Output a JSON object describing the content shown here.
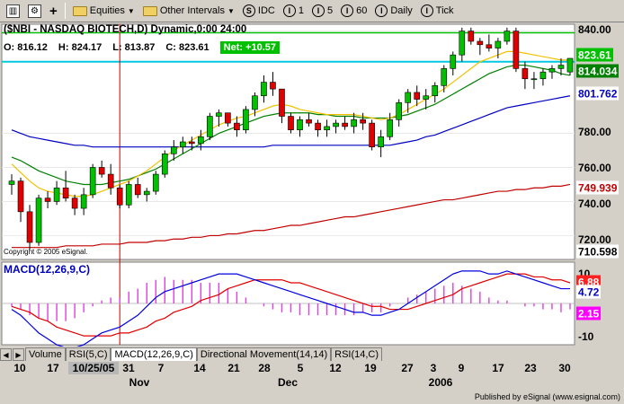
{
  "toolbar": {
    "equities_label": "Equities",
    "intervals_label": "Other Intervals",
    "intervals": [
      {
        "icon": "S",
        "label": "IDC"
      },
      {
        "icon": "I",
        "label": "1"
      },
      {
        "icon": "I",
        "label": "5"
      },
      {
        "icon": "I",
        "label": "60"
      },
      {
        "icon": "I",
        "label": "Daily"
      },
      {
        "icon": "I",
        "label": "Tick"
      }
    ]
  },
  "chart": {
    "title": "($NBI - NASDAQ BIOTECH,D) Dynamic,0:00 24:00",
    "open": "O: 816.12",
    "high": "H: 824.17",
    "low": "L: 813.87",
    "close": "C: 823.61",
    "net": "Net: +10.57",
    "copyright": "Copyright © 2005 eSignal.",
    "price_badges": [
      {
        "label": "823.61",
        "bg": "#00c000",
        "fg": "#ffffff"
      },
      {
        "label": "814.034",
        "bg": "#008000",
        "fg": "#ffffff"
      },
      {
        "label": "801.762",
        "bg": "#ffffff",
        "fg": "#0000c0"
      },
      {
        "label": "749.939",
        "bg": "#ffffff",
        "fg": "#c00000"
      },
      {
        "label": "710.598",
        "bg": "#ffffff",
        "fg": "#000000"
      }
    ],
    "y_ticks": [
      "840.00",
      "780.00",
      "760.00",
      "740.00",
      "720.00"
    ],
    "macd_label": "MACD(12,26,9,C)",
    "macd_badges": [
      {
        "label": "6.88",
        "bg": "#ff2020",
        "fg": "#ffffff"
      },
      {
        "label": "4.72",
        "bg": "#ffffff",
        "fg": "#0000c0"
      },
      {
        "label": "2.15",
        "bg": "#ff00ff",
        "fg": "#ffffff"
      }
    ],
    "macd_ticks": [
      "10",
      "-10"
    ]
  },
  "tabs": [
    "Volume",
    "RSI(5,C)",
    "MACD(12,26,9,C)",
    "Directional Movement(14,14)",
    "RSI(14,C)"
  ],
  "x_axis": {
    "days": [
      "10",
      "17",
      "10/25/05",
      "31",
      "7",
      "14",
      "21",
      "28",
      "5",
      "12",
      "19",
      "27",
      "3",
      "9",
      "17",
      "23",
      "30"
    ],
    "months": [
      "Nov",
      "Dec",
      "2006"
    ]
  },
  "footer": "Published by eSignal (www.esignal.com)",
  "colors": {
    "sma_fast": "#f0c000",
    "sma_mid": "#008000",
    "sma_slow": "#0000c0",
    "sma_long": "#c00000",
    "up": "#00c000",
    "down": "#e00000",
    "ref_line_green": "#00c000",
    "ref_line_cyan": "#00c8e0"
  },
  "chart_data": {
    "type": "candlestick",
    "title": "($NBI - NASDAQ BIOTECH,D) Dynamic,0:00 24:00",
    "ylim": [
      706,
      844
    ],
    "candles": [
      [
        750,
        756,
        744,
        752
      ],
      [
        752,
        754,
        728,
        734
      ],
      [
        734,
        738,
        712,
        716
      ],
      [
        716,
        744,
        714,
        742
      ],
      [
        742,
        746,
        736,
        740
      ],
      [
        740,
        752,
        738,
        748
      ],
      [
        748,
        758,
        740,
        742
      ],
      [
        742,
        744,
        732,
        736
      ],
      [
        736,
        748,
        732,
        744
      ],
      [
        744,
        762,
        742,
        760
      ],
      [
        760,
        764,
        754,
        756
      ],
      [
        756,
        762,
        744,
        748
      ],
      [
        748,
        750,
        736,
        738
      ],
      [
        738,
        752,
        736,
        750
      ],
      [
        750,
        754,
        742,
        744
      ],
      [
        744,
        748,
        740,
        746
      ],
      [
        746,
        758,
        744,
        756
      ],
      [
        756,
        770,
        754,
        768
      ],
      [
        768,
        776,
        764,
        772
      ],
      [
        772,
        778,
        768,
        775
      ],
      [
        775,
        778,
        770,
        774
      ],
      [
        774,
        782,
        770,
        778
      ],
      [
        778,
        792,
        776,
        790
      ],
      [
        790,
        794,
        784,
        792
      ],
      [
        792,
        792,
        784,
        786
      ],
      [
        786,
        790,
        778,
        782
      ],
      [
        782,
        796,
        780,
        794
      ],
      [
        794,
        804,
        790,
        802
      ],
      [
        802,
        814,
        798,
        810
      ],
      [
        810,
        816,
        802,
        806
      ],
      [
        806,
        806,
        786,
        790
      ],
      [
        790,
        792,
        780,
        782
      ],
      [
        782,
        790,
        778,
        788
      ],
      [
        788,
        792,
        784,
        786
      ],
      [
        786,
        788,
        778,
        782
      ],
      [
        782,
        788,
        778,
        784
      ],
      [
        784,
        788,
        780,
        786
      ],
      [
        786,
        790,
        782,
        784
      ],
      [
        784,
        792,
        780,
        788
      ],
      [
        788,
        792,
        782,
        786
      ],
      [
        786,
        788,
        770,
        772
      ],
      [
        772,
        782,
        766,
        778
      ],
      [
        778,
        792,
        776,
        788
      ],
      [
        788,
        800,
        784,
        798
      ],
      [
        798,
        806,
        792,
        804
      ],
      [
        804,
        808,
        796,
        800
      ],
      [
        800,
        806,
        794,
        802
      ],
      [
        802,
        810,
        798,
        808
      ],
      [
        808,
        820,
        804,
        818
      ],
      [
        818,
        828,
        814,
        826
      ],
      [
        826,
        842,
        822,
        840
      ],
      [
        840,
        842,
        832,
        834
      ],
      [
        834,
        836,
        826,
        832
      ],
      [
        832,
        838,
        828,
        830
      ],
      [
        830,
        836,
        824,
        834
      ],
      [
        834,
        842,
        832,
        840
      ],
      [
        840,
        842,
        816,
        818
      ],
      [
        818,
        822,
        806,
        812
      ],
      [
        812,
        816,
        806,
        812
      ],
      [
        812,
        818,
        808,
        816
      ],
      [
        816,
        820,
        812,
        818
      ],
      [
        818,
        824,
        814,
        820
      ],
      [
        816,
        824,
        814,
        824
      ]
    ],
    "sma_fast": [
      762,
      757,
      752,
      748,
      746,
      745,
      744,
      743,
      743,
      744,
      746,
      748,
      750,
      752,
      755,
      758,
      762,
      766,
      770,
      773,
      776,
      779,
      782,
      785,
      787,
      789,
      790,
      792,
      794,
      796,
      797,
      796,
      794,
      793,
      792,
      791,
      791,
      791,
      791,
      790,
      789,
      788,
      789,
      791,
      794,
      797,
      800,
      803,
      806,
      810,
      814,
      818,
      822,
      824,
      826,
      828,
      828,
      827,
      826,
      825,
      824,
      823,
      823
    ],
    "sma_mid": [
      766,
      764,
      761,
      758,
      756,
      754,
      752,
      751,
      750,
      750,
      750,
      751,
      752,
      753,
      755,
      757,
      759,
      762,
      765,
      768,
      771,
      774,
      777,
      780,
      782,
      784,
      786,
      788,
      790,
      791,
      792,
      792,
      792,
      792,
      791,
      791,
      790,
      790,
      790,
      789,
      789,
      789,
      789,
      790,
      791,
      793,
      795,
      797,
      800,
      803,
      806,
      809,
      812,
      815,
      817,
      819,
      820,
      820,
      819,
      818,
      817,
      815,
      814
    ],
    "sma_slow": [
      782,
      780,
      778,
      777,
      776,
      775,
      774,
      773,
      773,
      772,
      772,
      772,
      772,
      772,
      772,
      772,
      772,
      772,
      772,
      772,
      772,
      772,
      772,
      772,
      772,
      772,
      772,
      772,
      772,
      773,
      773,
      773,
      773,
      773,
      773,
      773,
      773,
      773,
      773,
      773,
      773,
      773,
      773,
      774,
      775,
      776,
      778,
      779,
      781,
      783,
      785,
      787,
      789,
      791,
      793,
      795,
      796,
      797,
      798,
      799,
      800,
      801,
      802
    ],
    "sma_long": [
      713,
      713,
      713,
      713,
      713,
      713,
      714,
      714,
      714,
      714,
      715,
      715,
      715,
      716,
      716,
      716,
      717,
      717,
      718,
      718,
      719,
      719,
      720,
      720,
      721,
      721,
      722,
      723,
      723,
      724,
      725,
      726,
      726,
      727,
      728,
      729,
      730,
      731,
      731,
      732,
      733,
      734,
      735,
      736,
      737,
      738,
      739,
      740,
      741,
      741,
      742,
      743,
      744,
      745,
      746,
      746,
      747,
      747,
      748,
      748,
      749,
      749,
      750
    ],
    "macd": [
      -2,
      -4,
      -7,
      -10,
      -12,
      -14,
      -15,
      -15,
      -14,
      -12,
      -10,
      -9,
      -8,
      -6,
      -4,
      -1,
      2,
      4,
      5,
      6,
      7,
      8,
      9,
      10,
      10,
      10,
      9,
      8,
      7,
      6,
      5,
      4,
      3,
      2,
      1,
      0,
      -1,
      -2,
      -3,
      -3,
      -4,
      -4,
      -3,
      -2,
      0,
      2,
      4,
      6,
      8,
      10,
      11,
      11,
      11,
      10,
      10,
      11,
      10,
      9,
      8,
      7,
      6,
      5,
      5
    ],
    "signal": [
      -1,
      -2,
      -3,
      -5,
      -6,
      -8,
      -9,
      -10,
      -11,
      -11,
      -11,
      -11,
      -10,
      -10,
      -9,
      -8,
      -6,
      -5,
      -3,
      -2,
      -1,
      1,
      2,
      3,
      5,
      6,
      7,
      8,
      8,
      8,
      8,
      7,
      7,
      6,
      5,
      4,
      3,
      2,
      1,
      0,
      -1,
      -1,
      -2,
      -2,
      -2,
      -1,
      0,
      1,
      2,
      3,
      5,
      6,
      7,
      8,
      9,
      10,
      10,
      10,
      9,
      9,
      8,
      8,
      7
    ],
    "hist": [
      -1,
      -2,
      -4,
      -5,
      -6,
      -6,
      -6,
      -5,
      -3,
      -1,
      1,
      2,
      2,
      4,
      5,
      7,
      8,
      9,
      8,
      8,
      8,
      7,
      7,
      7,
      5,
      4,
      2,
      0,
      -1,
      -2,
      -3,
      -3,
      -4,
      -4,
      -4,
      -4,
      -4,
      -4,
      -4,
      -3,
      -3,
      -3,
      -1,
      0,
      2,
      3,
      4,
      5,
      6,
      7,
      6,
      5,
      4,
      2,
      1,
      1,
      0,
      -1,
      -1,
      -2,
      -2,
      -3,
      -2
    ],
    "macd_ylim": [
      -14,
      14
    ]
  }
}
